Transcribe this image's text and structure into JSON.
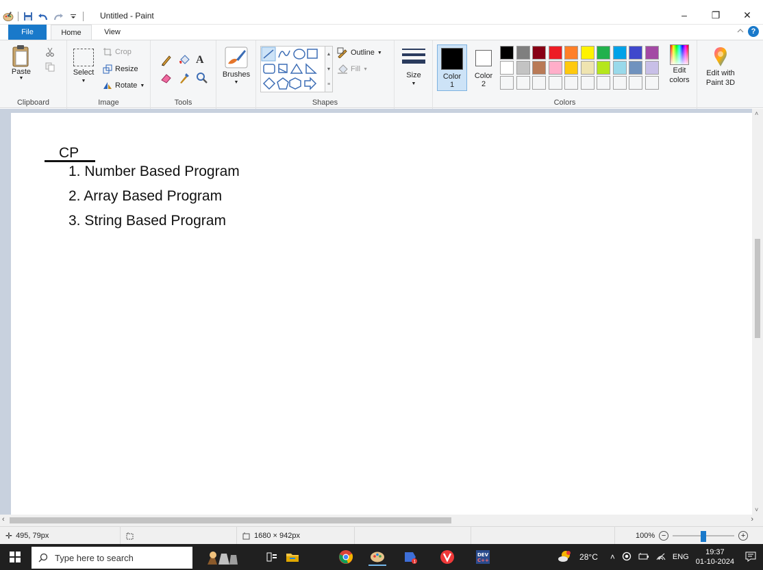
{
  "window": {
    "title": "Untitled - Paint",
    "minimize": "–",
    "restore": "❐",
    "close": "✕"
  },
  "tabs": {
    "file": "File",
    "home": "Home",
    "view": "View"
  },
  "ribbon": {
    "clipboard": {
      "paste": "Paste",
      "label": "Clipboard"
    },
    "image": {
      "select": "Select",
      "crop": "Crop",
      "resize": "Resize",
      "rotate": "Rotate",
      "label": "Image"
    },
    "tools": {
      "label": "Tools"
    },
    "brushes": {
      "label": "Brushes"
    },
    "shapes": {
      "outline": "Outline",
      "fill": "Fill",
      "label": "Shapes"
    },
    "size": {
      "label": "Size"
    },
    "colors": {
      "color1": "Color",
      "color1_num": "1",
      "color2": "Color",
      "color2_num": "2",
      "edit": "Edit",
      "edit2": "colors",
      "label": "Colors",
      "color1_value": "#000000",
      "color2_value": "#ffffff",
      "palette_row1": [
        "#000000",
        "#7f7f7f",
        "#880015",
        "#ed1c24",
        "#ff7f27",
        "#fff200",
        "#22b14c",
        "#00a2e8",
        "#3f48cc",
        "#a349a4"
      ],
      "palette_row2": [
        "#ffffff",
        "#c3c3c3",
        "#b97a57",
        "#ffaec9",
        "#ffc90e",
        "#efe4b0",
        "#b5e61d",
        "#99d9ea",
        "#7092be",
        "#c8bfe7"
      ]
    },
    "paint3d": {
      "line1": "Edit with",
      "line2": "Paint 3D"
    }
  },
  "document": {
    "heading": "CP",
    "items": [
      "1. Number Based Program",
      "2. Array Based Program",
      "3. String Based Program"
    ]
  },
  "status": {
    "cursor_pos": "495, 79px",
    "image_size": "1680 × 942px",
    "zoom": "100%",
    "zoom_level": 0.5
  },
  "taskbar": {
    "search_placeholder": "Type here to search",
    "temperature": "28°C",
    "language": "ENG",
    "time": "19:37",
    "date": "01-10-2024"
  }
}
